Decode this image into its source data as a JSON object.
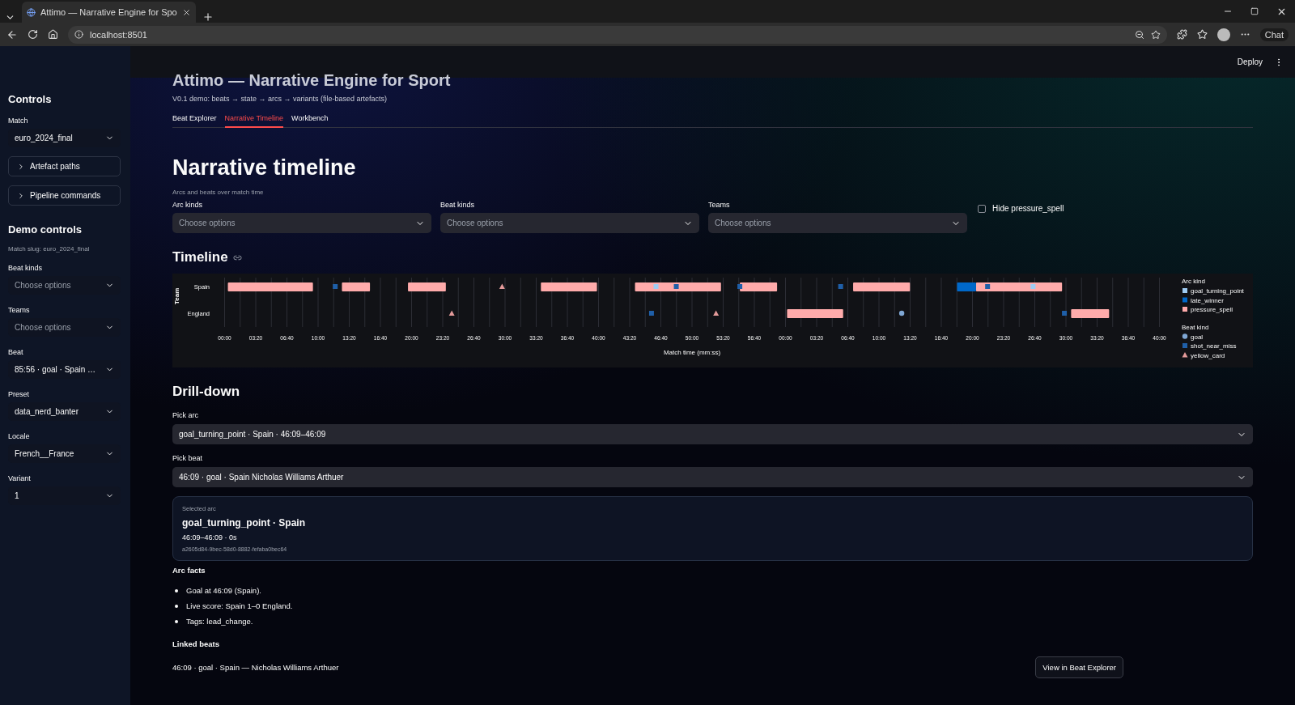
{
  "browser": {
    "tab_title": "Attimo — Narrative Engine for Spo",
    "address": "localhost:8501",
    "chat_label": "Chat"
  },
  "header": {
    "deploy": "Deploy"
  },
  "sidebar": {
    "title": "Controls",
    "match": {
      "label": "Match",
      "value": "euro_2024_final"
    },
    "expanders": [
      {
        "label": "Artefact paths",
        "expanded": false
      },
      {
        "label": "Pipeline commands",
        "expanded": false
      }
    ],
    "demo_title": "Demo controls",
    "caption": "Match slug: euro_2024_final",
    "fields": [
      {
        "label": "Beat kinds",
        "placeholder": "Choose options"
      },
      {
        "label": "Teams",
        "placeholder": "Choose options"
      },
      {
        "label": "Beat",
        "value": "85:56 · goal · Spain …"
      },
      {
        "label": "Preset",
        "value": "data_nerd_banter"
      },
      {
        "label": "Locale",
        "value": "French__France"
      },
      {
        "label": "Variant",
        "value": "1"
      }
    ]
  },
  "main": {
    "title": "Attimo — Narrative Engine for Sport",
    "subtitle": "V0.1 demo: beats → state → arcs → variants (file-based artefacts)",
    "tabs": [
      {
        "label": "Beat Explorer",
        "selected": false
      },
      {
        "label": "Narrative Timeline",
        "selected": true
      },
      {
        "label": "Workbench",
        "selected": false
      }
    ],
    "heading": "Narrative timeline",
    "caption": "Arcs and beats over match time",
    "filters": [
      {
        "label": "Arc kinds",
        "placeholder": "Choose options"
      },
      {
        "label": "Beat kinds",
        "placeholder": "Choose options"
      },
      {
        "label": "Teams",
        "placeholder": "Choose options"
      }
    ],
    "hide_checkbox": {
      "label": "Hide pressure_spell",
      "checked": false
    },
    "timeline": {
      "heading": "Timeline",
      "ylabel": "Team",
      "rows": [
        "Spain",
        "England"
      ],
      "ticks": [
        "00:00",
        "03:20",
        "06:40",
        "10:00",
        "13:20",
        "16:40",
        "20:00",
        "23:20",
        "26:40",
        "30:00",
        "33:20",
        "36:40",
        "40:00",
        "43:20",
        "46:40",
        "50:00",
        "53:20",
        "56:40",
        "00:00",
        "03:20",
        "06:40",
        "10:00",
        "13:20",
        "16:40",
        "20:00",
        "23:20",
        "26:40",
        "30:00",
        "33:20",
        "36:40",
        "40:00"
      ],
      "xlabel": "Match time (mm:ss)",
      "legend": [
        {
          "title": "Arc kind",
          "items": [
            {
              "name": "goal_turning_point",
              "color": "#9ecbf2",
              "kind": "square"
            },
            {
              "name": "late_winner",
              "color": "#0068c9",
              "kind": "square"
            },
            {
              "name": "pressure_spell",
              "color": "#ffabab",
              "kind": "square"
            }
          ]
        },
        {
          "title": "Beat kind",
          "items": [
            {
              "name": "goal",
              "color": "#7fa7d4",
              "kind": "circle"
            },
            {
              "name": "shot_near_miss",
              "color": "#1f5fa8",
              "kind": "square"
            },
            {
              "name": "yellow_card",
              "color": "#e39a9a",
              "kind": "triangle"
            }
          ]
        }
      ]
    },
    "drilldown": {
      "heading": "Drill-down",
      "selects": [
        {
          "label": "Pick arc",
          "value": "goal_turning_point · Spain · 46:09–46:09"
        },
        {
          "label": "Pick beat",
          "value": "46:09 · goal · Spain Nicholas Williams Arthuer"
        }
      ],
      "card": {
        "caption": "Selected arc",
        "title": "goal_turning_point · Spain",
        "span": "46:09–46:09 · 0s",
        "id": "a2605d84-9bec-58d0-8882-fefaba0bec64"
      },
      "facts_heading": "Arc facts",
      "facts": [
        "Goal at 46:09 (Spain).",
        "Live score: Spain 1–0 England.",
        "Tags: lead_change."
      ],
      "linked_heading": "Linked beats",
      "linked": "46:09 · goal · Spain — Nicholas Williams Arthuer",
      "button": "View in Beat Explorer"
    }
  }
}
